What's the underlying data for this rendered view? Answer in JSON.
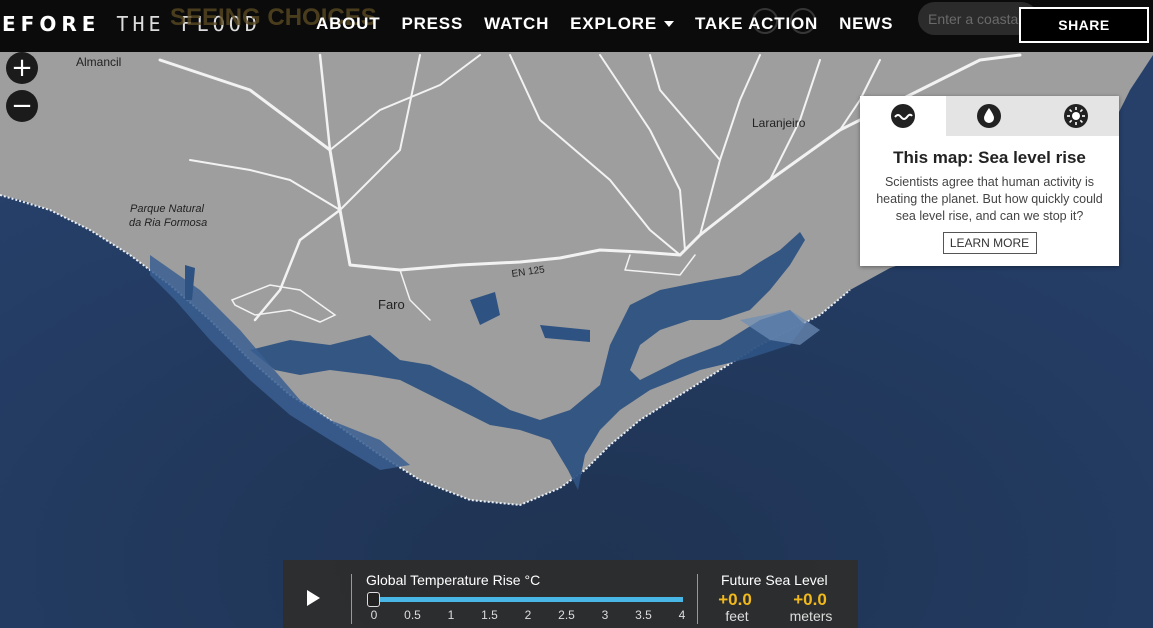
{
  "header": {
    "logo_part1": "EFORE",
    "logo_part2": " THE FLOOD",
    "ghost_title": "SEEING CHOICES",
    "nav": [
      {
        "label": "ABOUT"
      },
      {
        "label": "PRESS"
      },
      {
        "label": "WATCH"
      },
      {
        "label": "EXPLORE"
      },
      {
        "label": "TAKE ACTION"
      },
      {
        "label": "NEWS"
      }
    ],
    "search_placeholder": "Enter a coastal city",
    "share_label": "SHARE"
  },
  "zoom": {
    "in_label": "+",
    "out_label": "−"
  },
  "map_labels": {
    "almancil": "Almancil",
    "laranjeiro": "Laranjeiro",
    "parque_line1": "Parque Natural",
    "parque_line2": "da Ria Formosa",
    "faro": "Faro",
    "road": "EN 125"
  },
  "info_panel": {
    "tabs": [
      {
        "icon": "wave-icon"
      },
      {
        "icon": "water-drop-icon"
      },
      {
        "icon": "sun-icon"
      }
    ],
    "title": "This map: Sea level rise",
    "body": "Scientists agree that human activity is heating the planet. But how quickly could sea level rise, and can we stop it?",
    "button_label": "LEARN MORE"
  },
  "control": {
    "slider_title": "Global Temperature Rise °C",
    "ticks": [
      "0",
      "0.5",
      "1",
      "1.5",
      "2",
      "2.5",
      "3",
      "3.5",
      "4"
    ],
    "current_value": 0,
    "future_title": "Future Sea Level",
    "feet_value": "+0.0",
    "feet_unit": "feet",
    "meters_value": "+0.0",
    "meters_unit": "meters"
  },
  "colors": {
    "ocean": "#22385a",
    "land": "#9e9e9e",
    "flooded": "#2e5282",
    "slider": "#48b7e6",
    "value": "#f2b91c"
  }
}
